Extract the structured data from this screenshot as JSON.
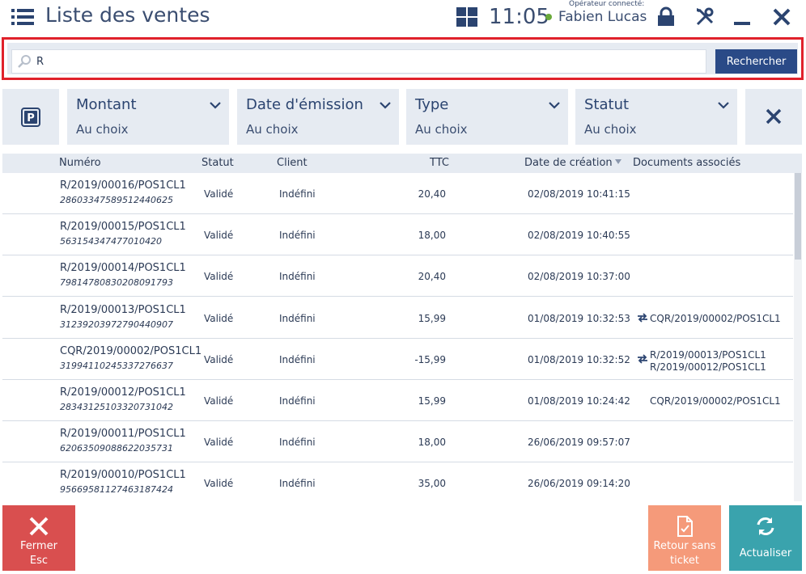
{
  "header": {
    "title": "Liste des ventes",
    "clock": "11:05",
    "operator_caption": "Opérateur connecté:",
    "operator_name": "Fabien Lucas",
    "status_color": "#6aaa3a"
  },
  "search": {
    "value": "R",
    "placeholder": "",
    "button_label": "Rechercher"
  },
  "filters": [
    {
      "label": "Montant",
      "value": "Au choix"
    },
    {
      "label": "Date d'émission",
      "value": "Au choix"
    },
    {
      "label": "Type",
      "value": "Au choix"
    },
    {
      "label": "Statut",
      "value": "Au choix"
    }
  ],
  "table": {
    "columns": {
      "numero": "Numéro",
      "statut": "Statut",
      "client": "Client",
      "ttc": "TTC",
      "date": "Date de création",
      "docs": "Documents associés"
    },
    "rows": [
      {
        "numero": "R/2019/00016/POS1CL1",
        "ref": "28603347589512440625",
        "statut": "Validé",
        "client": "Indéfini",
        "ttc": "20,40",
        "date": "02/08/2019 10:41:15",
        "docs": [],
        "doc_icon": false
      },
      {
        "numero": "R/2019/00015/POS1CL1",
        "ref": "563154347477010420",
        "statut": "Validé",
        "client": "Indéfini",
        "ttc": "18,00",
        "date": "02/08/2019 10:40:55",
        "docs": [],
        "doc_icon": false
      },
      {
        "numero": "R/2019/00014/POS1CL1",
        "ref": "79814780830208091793",
        "statut": "Validé",
        "client": "Indéfini",
        "ttc": "20,40",
        "date": "02/08/2019 10:37:00",
        "docs": [],
        "doc_icon": false
      },
      {
        "numero": "R/2019/00013/POS1CL1",
        "ref": "31239203972790440907",
        "statut": "Validé",
        "client": "Indéfini",
        "ttc": "15,99",
        "date": "01/08/2019 10:32:53",
        "docs": [
          "CQR/2019/00002/POS1CL1"
        ],
        "doc_icon": true
      },
      {
        "numero": "CQR/2019/00002/POS1CL1",
        "ref": "31994110245337276637",
        "statut": "Validé",
        "client": "Indéfini",
        "ttc": "-15,99",
        "date": "01/08/2019 10:32:52",
        "docs": [
          "R/2019/00013/POS1CL1",
          "R/2019/00012/POS1CL1"
        ],
        "doc_icon": true
      },
      {
        "numero": "R/2019/00012/POS1CL1",
        "ref": "28343125103320731042",
        "statut": "Validé",
        "client": "Indéfini",
        "ttc": "15,99",
        "date": "01/08/2019 10:24:42",
        "docs": [
          "CQR/2019/00002/POS1CL1"
        ],
        "doc_icon": false
      },
      {
        "numero": "R/2019/00011/POS1CL1",
        "ref": "62063509088622035731",
        "statut": "Validé",
        "client": "Indéfini",
        "ttc": "18,00",
        "date": "26/06/2019 09:57:07",
        "docs": [],
        "doc_icon": false
      },
      {
        "numero": "R/2019/00010/POS1CL1",
        "ref": "95669581127463187424",
        "statut": "Validé",
        "client": "Indéfini",
        "ttc": "35,00",
        "date": "26/06/2019 09:14:20",
        "docs": [],
        "doc_icon": false
      }
    ]
  },
  "buttons": {
    "fermer_line1": "Fermer",
    "fermer_line2": "Esc",
    "retour_line1": "Retour sans",
    "retour_line2": "ticket",
    "actualiser": "Actualiser"
  },
  "colors": {
    "accent": "#2a4a87",
    "highlight": "#e0212b",
    "close": "#d94f4f",
    "return": "#f59a7a",
    "refresh": "#3aa3ad"
  },
  "icons": [
    "menu-icon",
    "grid-icon",
    "lock-icon",
    "tools-icon",
    "minimize-icon",
    "close-icon",
    "search-icon",
    "parking-icon",
    "chevron-down-icon",
    "clear-filters-icon",
    "sort-desc-icon",
    "swap-icon",
    "document-icon",
    "refresh-icon"
  ]
}
